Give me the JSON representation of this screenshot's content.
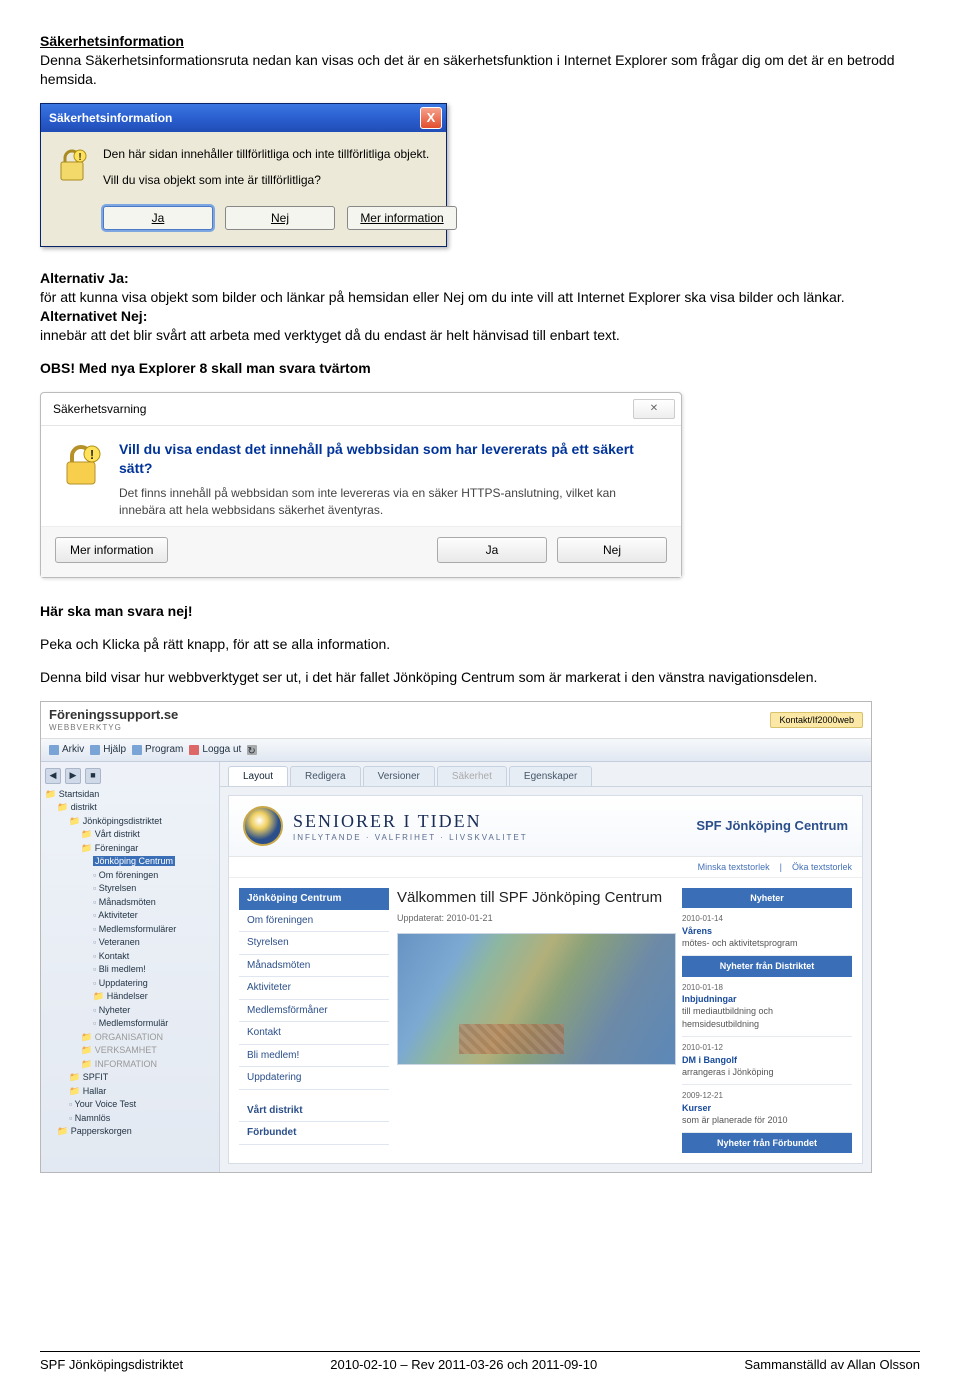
{
  "doc": {
    "h1": "Säkerhetsinformation",
    "intro": "Denna Säkerhetsinformationsruta nedan kan visas och det är en säkerhetsfunktion i Internet Explorer som frågar dig om det är en betrodd hemsida.",
    "altJaLabel": "Alternativ  Ja:",
    "altJaText": "för att kunna visa objekt som bilder och länkar på hemsidan eller Nej om du inte vill att Internet Explorer ska visa bilder och länkar.",
    "altNejLabel": "Alternativet Nej:",
    "altNejText": "innebär att det blir svårt att arbeta med verktyget då du endast är helt hänvisad till enbart text.",
    "obs": "OBS! Med nya Explorer 8 skall man svara tvärtom",
    "svaraNej": "Här ska man svara nej!",
    "peka": "Peka och Klicka på rätt knapp, för att se alla information.",
    "webinfo": "Denna bild visar hur webbverktyget ser ut, i det här fallet Jönköping Centrum som är markerat i den vänstra navigationsdelen."
  },
  "xp": {
    "title": "Säkerhetsinformation",
    "line1": "Den här sidan innehåller tillförlitliga och inte tillförlitliga objekt.",
    "line2": "Vill du visa objekt som inte är tillförlitliga?",
    "btnJa": "Ja",
    "btnNej": "Nej",
    "btnMer": "Mer information",
    "close": "X"
  },
  "w7": {
    "title": "Säkerhetsvarning",
    "closeGlyph": "�ص�",
    "q": "Vill du visa endast det innehåll på webbsidan som har levererats på ett säkert sätt?",
    "desc": "Det finns innehåll på webbsidan som inte levereras via en säker HTTPS-anslutning, vilket kan innebära att hela webbsidans säkerhet äventyras.",
    "btnMer": "Mer information",
    "btnJa": "Ja",
    "btnNej": "Nej"
  },
  "ws": {
    "brand": "Föreningssupport.se",
    "brandSub": "WEBBVERKTYG",
    "contact": "Kontakt/If2000web",
    "menu": {
      "arkiv": "Arkiv",
      "hjalp": "Hjälp",
      "program": "Program",
      "logga": "Logga ut"
    },
    "tree": {
      "start": "Startsidan",
      "distrikt": "distrikt",
      "jdist": "Jönköpingsdistriktet",
      "vart": "Vårt distrikt",
      "foreningar": "Föreningar",
      "jc": "Jönköping Centrum",
      "omforening": "Om föreningen",
      "styrelsen": "Styrelsen",
      "manads": "Månadsmöten",
      "aktivitet": "Aktiviteter",
      "medlemsform": "Medlemsformulärer",
      "veteranen": "Veteranen",
      "kontakt": "Kontakt",
      "blimedlem": "Bli medlem!",
      "uppdat": "Uppdatering",
      "handelsm": "Händelser",
      "nyheter": "Nyheter",
      "medlemsform2": "Medlemsformulär",
      "org": "ORGANISATION",
      "verk": "VERKSAMHET",
      "info": "INFORMATION",
      "spfit": "SPFIT",
      "hallar": "Hallar",
      "yvt": "Your Voice Test",
      "namnlos": "Namnlös",
      "papperskorgen": "Papperskorgen"
    },
    "tabs": {
      "layout": "Layout",
      "redigera": "Redigera",
      "versioner": "Versioner",
      "sakerhet": "Säkerhet",
      "egensk": "Egenskaper"
    },
    "banner": {
      "title": "SENIORER I TIDEN",
      "sub": "INFLYTANDE · VALFRIHET · LIVSKVALITET",
      "site": "SPF Jönköping Centrum",
      "tool1": "Minska textstorlek",
      "tool2": "Öka textstorlek"
    },
    "leftnav": {
      "header": "Jönköping Centrum",
      "i1": "Om föreningen",
      "i2": "Styrelsen",
      "i3": "Månadsmöten",
      "i4": "Aktiviteter",
      "i5": "Medlemsförmåner",
      "i6": "Kontakt",
      "i7": "Bli medlem!",
      "i8": "Uppdatering",
      "sec1": "Vårt distrikt",
      "sec2": "Förbundet"
    },
    "center": {
      "h": "Välkommen till SPF Jönköping Centrum",
      "upd": "Uppdaterat: 2010-01-21"
    },
    "right": {
      "h1": "Nyheter",
      "r1date": "2010-01-14",
      "r1tit": "Vårens",
      "r1desc": "mötes- och aktivitetsprogram",
      "h2": "Nyheter från Distriktet",
      "r2date": "2010-01-18",
      "r2tit": "Inbjudningar",
      "r2desc": "till mediautbildning och hemsidesutbildning",
      "r3date": "2010-01-12",
      "r3tit": "DM i Bangolf",
      "r3desc": "arrangeras i Jönköping",
      "r4date": "2009-12-21",
      "r4tit": "Kurser",
      "r4desc": "som är planerade för 2010",
      "h3": "Nyheter från Förbundet"
    }
  },
  "footer": {
    "left": "SPF Jönköpingsdistriktet",
    "mid": "2010-02-10 – Rev 2011-03-26 och 2011-09-10",
    "right": "Sammanställd av Allan Olsson"
  }
}
